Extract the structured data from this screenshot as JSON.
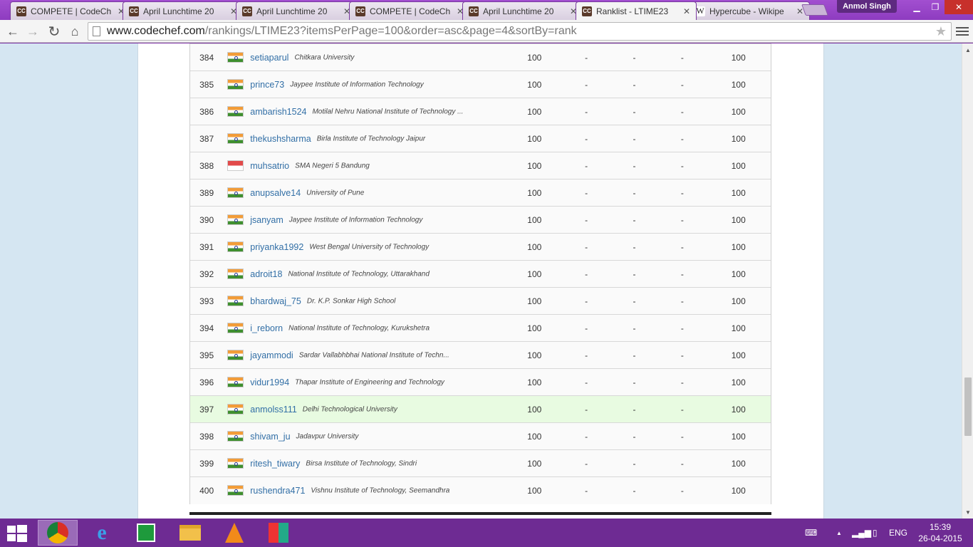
{
  "browser": {
    "tabs": [
      {
        "favicon": "CC",
        "title": "COMPETE | CodeCh",
        "active": false
      },
      {
        "favicon": "CC",
        "title": "April Lunchtime 20",
        "active": false
      },
      {
        "favicon": "CC",
        "title": "April Lunchtime 20",
        "active": false
      },
      {
        "favicon": "CC",
        "title": "COMPETE | CodeCh",
        "active": false
      },
      {
        "favicon": "CC",
        "title": "April Lunchtime 20",
        "active": false
      },
      {
        "favicon": "CC",
        "title": "Ranklist - LTIME23",
        "active": true
      },
      {
        "favicon": "W",
        "title": "Hypercube - Wikipe",
        "active": false
      }
    ],
    "user_name": "Anmol Singh",
    "url_host": "www.codechef.com",
    "url_path": "/rankings/LTIME23?itemsPerPage=100&order=asc&page=4&sortBy=rank"
  },
  "ranklist": {
    "rows": [
      {
        "rank": "384",
        "flag": "india",
        "user": "setiaparul",
        "institution": "Chitkara University",
        "score": "100",
        "p1": "-",
        "p2": "-",
        "p3": "-",
        "total": "100",
        "highlight": false
      },
      {
        "rank": "385",
        "flag": "india",
        "user": "prince73",
        "institution": "Jaypee Institute of Information Technology",
        "score": "100",
        "p1": "-",
        "p2": "-",
        "p3": "-",
        "total": "100",
        "highlight": false
      },
      {
        "rank": "386",
        "flag": "india",
        "user": "ambarish1524",
        "institution": "Motilal Nehru National Institute of Technology ...",
        "score": "100",
        "p1": "-",
        "p2": "-",
        "p3": "-",
        "total": "100",
        "highlight": false
      },
      {
        "rank": "387",
        "flag": "india",
        "user": "thekushsharma",
        "institution": "Birla Institute of Technology Jaipur",
        "score": "100",
        "p1": "-",
        "p2": "-",
        "p3": "-",
        "total": "100",
        "highlight": false
      },
      {
        "rank": "388",
        "flag": "indonesia",
        "user": "muhsatrio",
        "institution": "SMA Negeri 5 Bandung",
        "score": "100",
        "p1": "-",
        "p2": "-",
        "p3": "-",
        "total": "100",
        "highlight": false
      },
      {
        "rank": "389",
        "flag": "india",
        "user": "anupsalve14",
        "institution": "University of Pune",
        "score": "100",
        "p1": "-",
        "p2": "-",
        "p3": "-",
        "total": "100",
        "highlight": false
      },
      {
        "rank": "390",
        "flag": "india",
        "user": "jsanyam",
        "institution": "Jaypee Institute of Information Technology",
        "score": "100",
        "p1": "-",
        "p2": "-",
        "p3": "-",
        "total": "100",
        "highlight": false
      },
      {
        "rank": "391",
        "flag": "india",
        "user": "priyanka1992",
        "institution": "West Bengal University of Technology",
        "score": "100",
        "p1": "-",
        "p2": "-",
        "p3": "-",
        "total": "100",
        "highlight": false
      },
      {
        "rank": "392",
        "flag": "india",
        "user": "adroit18",
        "institution": "National Institute of Technology, Uttarakhand",
        "score": "100",
        "p1": "-",
        "p2": "-",
        "p3": "-",
        "total": "100",
        "highlight": false
      },
      {
        "rank": "393",
        "flag": "india",
        "user": "bhardwaj_75",
        "institution": "Dr. K.P. Sonkar High School",
        "score": "100",
        "p1": "-",
        "p2": "-",
        "p3": "-",
        "total": "100",
        "highlight": false
      },
      {
        "rank": "394",
        "flag": "india",
        "user": "i_reborn",
        "institution": "National Institute of Technology, Kurukshetra",
        "score": "100",
        "p1": "-",
        "p2": "-",
        "p3": "-",
        "total": "100",
        "highlight": false
      },
      {
        "rank": "395",
        "flag": "india",
        "user": "jayammodi",
        "institution": "Sardar Vallabhbhai National Institute of Techn...",
        "score": "100",
        "p1": "-",
        "p2": "-",
        "p3": "-",
        "total": "100",
        "highlight": false
      },
      {
        "rank": "396",
        "flag": "india",
        "user": "vidur1994",
        "institution": "Thapar Institute of Engineering and Technology",
        "score": "100",
        "p1": "-",
        "p2": "-",
        "p3": "-",
        "total": "100",
        "highlight": false
      },
      {
        "rank": "397",
        "flag": "india",
        "user": "anmolss111",
        "institution": "Delhi Technological University",
        "score": "100",
        "p1": "-",
        "p2": "-",
        "p3": "-",
        "total": "100",
        "highlight": true
      },
      {
        "rank": "398",
        "flag": "india",
        "user": "shivam_ju",
        "institution": "Jadavpur University",
        "score": "100",
        "p1": "-",
        "p2": "-",
        "p3": "-",
        "total": "100",
        "highlight": false
      },
      {
        "rank": "399",
        "flag": "india",
        "user": "ritesh_tiwary",
        "institution": "Birsa Institute of Technology, Sindri",
        "score": "100",
        "p1": "-",
        "p2": "-",
        "p3": "-",
        "total": "100",
        "highlight": false
      },
      {
        "rank": "400",
        "flag": "india",
        "user": "rushendra471",
        "institution": "Vishnu Institute of Technology, Seemandhra",
        "score": "100",
        "p1": "-",
        "p2": "-",
        "p3": "-",
        "total": "100",
        "highlight": false
      }
    ]
  },
  "taskbar": {
    "apps": [
      "chrome-icon",
      "internet-explorer-icon",
      "store-icon",
      "file-explorer-icon",
      "vlc-icon",
      "app-tiles-icon"
    ],
    "language": "ENG",
    "time": "15:39",
    "date": "26-04-2015"
  },
  "colors": {
    "accent": "#7b2ea4",
    "link": "#326fa6",
    "highlight_row": "#e8fbe1",
    "page_bg": "#d5e6f2"
  }
}
